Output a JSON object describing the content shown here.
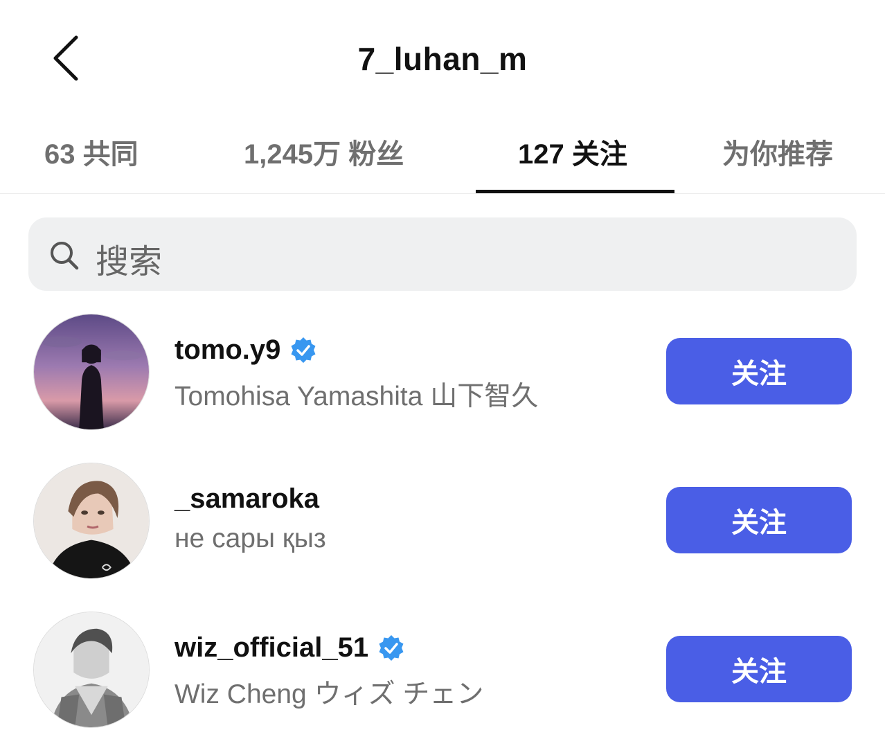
{
  "header": {
    "back_icon": "chevron-left-icon",
    "title": "7_luhan_m"
  },
  "tabs": [
    {
      "label": "63 共同",
      "active": false
    },
    {
      "label": "1,245万 粉丝",
      "active": false
    },
    {
      "label": "127 关注",
      "active": true
    },
    {
      "label": "为你推荐",
      "active": false
    }
  ],
  "search": {
    "icon": "search-icon",
    "placeholder": "搜索"
  },
  "accounts": [
    {
      "username": "tomo.y9",
      "verified": true,
      "full_name": "Tomohisa Yamashita 山下智久",
      "button_label": "关注"
    },
    {
      "username": "_samaroka",
      "verified": false,
      "full_name": "не сары қыз",
      "button_label": "关注"
    },
    {
      "username": "wiz_official_51",
      "verified": true,
      "full_name": "Wiz Cheng ウィズ チェン",
      "button_label": "关注"
    }
  ],
  "colors": {
    "accent": "#4a5ee6",
    "verified": "#3897f0",
    "secondary_text": "#6f6f6f",
    "search_bg": "#eff0f1"
  }
}
